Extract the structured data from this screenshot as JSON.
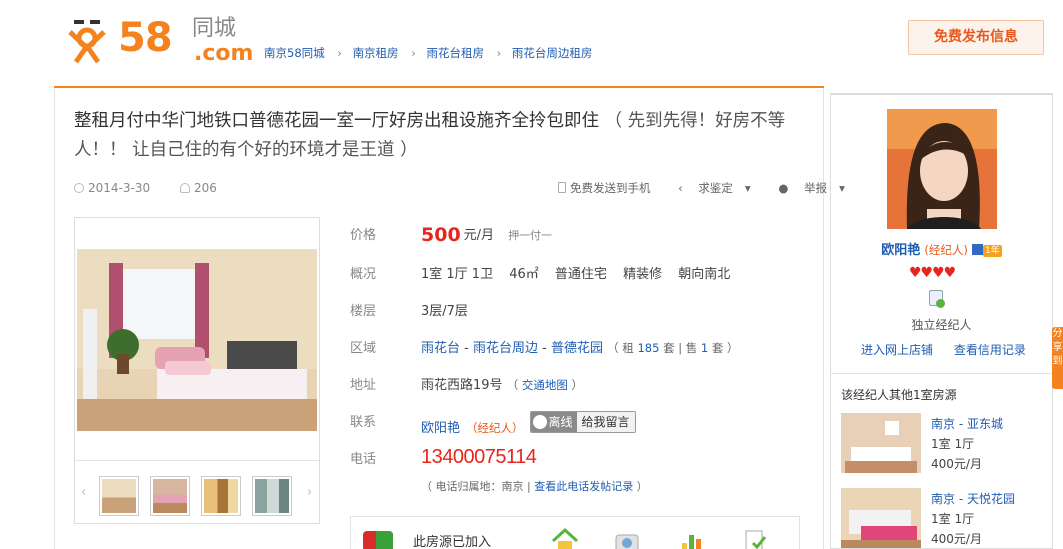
{
  "header": {
    "logo_number": "58",
    "logo_city": "同城",
    "logo_com": ".com",
    "breadcrumbs": [
      "南京58同城",
      "南京租房",
      "雨花台租房",
      "雨花台周边租房"
    ],
    "post_button": "免费发布信息"
  },
  "listing": {
    "title": "整租月付中华门地铁口普德花园一室一厅好房出租设施齐全拎包即住",
    "slogan": "（ 先到先得！好房不等人！！ 让自己住的有个好的环境才是王道 ）",
    "date": "2014-3-30",
    "views": "206",
    "tools": {
      "send_phone": "免费发送到手机",
      "appraise": "求鉴定",
      "report": "举报"
    }
  },
  "details": {
    "price_label": "价格",
    "price": "500",
    "price_unit": "元/月",
    "pay_method": "押一付一",
    "overview_label": "概况",
    "overview": [
      "1室 1厅 1卫",
      "46㎡",
      "普通住宅",
      "精装修",
      "朝向南北"
    ],
    "floor_label": "楼层",
    "floor": "3层/7层",
    "area_label": "区域",
    "area": [
      "雨花台",
      "雨花台周边",
      "普德花园"
    ],
    "area_sep": "-",
    "rent_count_prefix": "（ 租",
    "rent_count": "185",
    "rent_count_mid": "套 | 售",
    "sale_count": "1",
    "rent_count_suffix": "套 ）",
    "address_label": "地址",
    "address": "雨花西路19号",
    "map_link": "交通地图",
    "contact_label": "联系",
    "contact_name": "欧阳艳",
    "contact_role": "（经纪人）",
    "chat_status": "离线",
    "chat_msg": "给我留言",
    "phone_label": "电话",
    "phone": "13400075114",
    "phone_loc_prefix": "（ 电话归属地：南京 |",
    "phone_loc_link": "查看此电话发帖记录",
    "phone_loc_suffix": "）",
    "cert_text": "此房源已加入"
  },
  "agent": {
    "name": "欧阳艳",
    "role": "(经纪人)",
    "years": "1年",
    "hearts": "♥♥♥♥",
    "type": "独立经纪人",
    "link_shop": "进入网上店铺",
    "link_credit": "查看信用记录",
    "others_title": "该经纪人其他1室房源",
    "others": [
      {
        "name": "南京 - 亚东城",
        "rooms": "1室 1厅",
        "price": "400元/月"
      },
      {
        "name": "南京 - 天悦花园",
        "rooms": "1室 1厅",
        "price": "400元/月"
      }
    ]
  },
  "float_tab": "分享到"
}
